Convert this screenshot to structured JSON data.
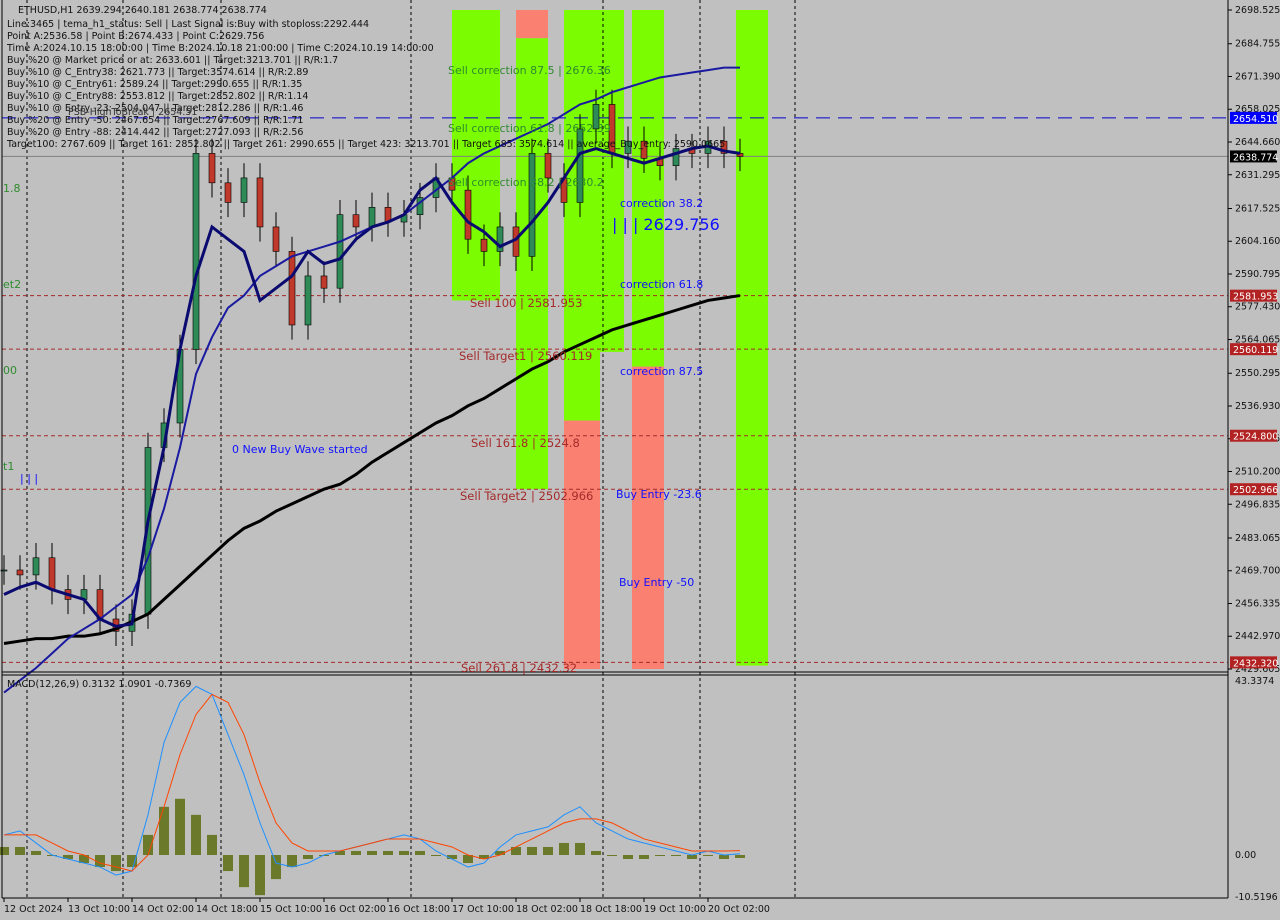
{
  "header": {
    "symbol_line": "ETHUSD,H1  2639.294 2640.181 2638.774 2638.774",
    "info_lines": [
      "Line:3465 | tema_h1_status: Sell | Last Signal is:Buy with stoploss:2292.444",
      "Point A:2536.58 | Point B:2674.433 | Point C:2629.756",
      "Time A:2024.10.15 18:00:00 | Time B:2024.10.18 21:00:00 | Time C:2024.10.19 14:00:00",
      "Buy %20 @ Market price or at: 2633.601 || Target:3213.701 || R/R:1.7",
      "Buy %10 @ C_Entry38: 2621.773 || Target:3574.614 || R/R:2.89",
      "Buy %10 @ C_Entry61: 2589.24 || Target:2990.655 || R/R:1.35",
      "Buy %10 @ C_Entry88: 2553.812 || Target:2852.802 || R/R:1.14",
      "Buy %10 @ Entry -23: 2504.047 || Target:2812.286 || R/R:1.46",
      "Buy %20 @ Entry -50: 2467.654 || Target:2767.609 || R/R:1.71",
      "Buy %20 @ Entry -88: 2414.442 || Target:2727.093 || R/R:2.56",
      "Target100: 2767.609 || Target 161: 2852.802 || Target 261: 2990.655 || Target 423: 3213.701 || Target 685: 3574.614 || average_Buy_entry: 2590.0665"
    ],
    "psb_label": "PSB-HighToBreak | 2654.51"
  },
  "annotations": {
    "sell_corr_875": "Sell correction 87.5 | 2676.36",
    "sell_corr_618": "Sell correction 61.8 | 2652.39",
    "sell_corr_382": "Sell correction 38.2 | 2630.2",
    "corr_382": "correction 38.2",
    "point_c": "| | | 2629.756",
    "corr_618": "correction 61.8",
    "corr_875": "correction 87.5",
    "buy_entry_236": "Buy Entry -23.6",
    "buy_entry_50": "Buy Entry -50",
    "sell_100": "Sell 100 | 2581.953",
    "sell_target1": "Sell Target1 | 2560.119",
    "sell_1618": "Sell 161.8 | 2524.8",
    "sell_target2": "Sell Target2 | 2502.966",
    "sell_2618": "Sell 261.8 | 2432.32",
    "new_wave": "0 New Buy Wave started",
    "left_edge": [
      "1.8",
      "et2",
      "00",
      "t1"
    ],
    "left_bars": "| | |"
  },
  "price_badges": [
    {
      "label": "2654.510",
      "value": 2654.51,
      "color": "#0000ff"
    },
    {
      "label": "2638.774",
      "value": 2638.774,
      "color": "#000000"
    },
    {
      "label": "2581.953",
      "value": 2581.953,
      "color": "#b22222"
    },
    {
      "label": "2560.119",
      "value": 2560.119,
      "color": "#b22222"
    },
    {
      "label": "2524.800",
      "value": 2524.8,
      "color": "#b22222"
    },
    {
      "label": "2502.966",
      "value": 2502.966,
      "color": "#b22222"
    },
    {
      "label": "2432.320",
      "value": 2432.32,
      "color": "#b22222"
    }
  ],
  "colors": {
    "background": "#c0c0c0",
    "bull_zone": "#7cfc00",
    "bear_zone": "#fa8072",
    "level": "#a52a2a",
    "ma_long": "#000000",
    "ma_mid": "#1a1aa0",
    "ma_fast": "#0a0a70",
    "macd": "#1e90ff",
    "signal": "#ff4500",
    "histogram": "#6b7a2a"
  },
  "chart_data": [
    {
      "type": "line",
      "title": "ETHUSD,H1",
      "xlabel": "",
      "ylabel": "",
      "ylim": [
        2429.605,
        2698.525
      ],
      "y_ticks": [
        "2698.525",
        "2684.755",
        "2671.390",
        "2658.025",
        "2644.660",
        "2631.295",
        "2617.525",
        "2604.160",
        "2590.795",
        "2577.430",
        "2564.065",
        "2550.295",
        "2536.930",
        "2523.565",
        "2510.200",
        "2496.835",
        "2483.065",
        "2469.700",
        "2456.335",
        "2442.970",
        "2429.605"
      ],
      "x_ticks": [
        "12 Oct 2024",
        "13 Oct 10:00",
        "14 Oct 02:00",
        "14 Oct 18:00",
        "15 Oct 10:00",
        "16 Oct 02:00",
        "16 Oct 18:00",
        "17 Oct 10:00",
        "18 Oct 02:00",
        "18 Oct 18:00",
        "19 Oct 10:00",
        "20 Oct 02:00"
      ],
      "x": [
        "12 Oct 18:00",
        "12 Oct 22:00",
        "13 Oct 02:00",
        "13 Oct 06:00",
        "13 Oct 10:00",
        "13 Oct 14:00",
        "13 Oct 18:00",
        "13 Oct 22:00",
        "14 Oct 02:00",
        "14 Oct 06:00",
        "14 Oct 10:00",
        "14 Oct 14:00",
        "14 Oct 18:00",
        "14 Oct 22:00",
        "15 Oct 02:00",
        "15 Oct 06:00",
        "15 Oct 10:00",
        "15 Oct 14:00",
        "15 Oct 18:00",
        "15 Oct 22:00",
        "16 Oct 02:00",
        "16 Oct 06:00",
        "16 Oct 10:00",
        "16 Oct 14:00",
        "16 Oct 18:00",
        "16 Oct 22:00",
        "17 Oct 02:00",
        "17 Oct 06:00",
        "17 Oct 10:00",
        "17 Oct 14:00",
        "17 Oct 18:00",
        "17 Oct 22:00",
        "18 Oct 02:00",
        "18 Oct 06:00",
        "18 Oct 10:00",
        "18 Oct 14:00",
        "18 Oct 18:00",
        "18 Oct 22:00",
        "19 Oct 02:00",
        "19 Oct 06:00",
        "19 Oct 10:00",
        "19 Oct 14:00",
        "19 Oct 18:00",
        "19 Oct 22:00",
        "20 Oct 02:00",
        "20 Oct 06:00",
        "20 Oct 09:00"
      ],
      "series": [
        {
          "values": [
            2470,
            2468,
            2475,
            2462,
            2458,
            2462,
            2450,
            2445,
            2452,
            2520,
            2530,
            2560,
            2640,
            2628,
            2620,
            2630,
            2610,
            2600,
            2570,
            2590,
            2585,
            2615,
            2610,
            2618,
            2612,
            2615,
            2622,
            2630,
            2625,
            2605,
            2600,
            2610,
            2598,
            2640,
            2630,
            2620,
            2650,
            2660,
            2640,
            2645,
            2638,
            2635,
            2642,
            2640,
            2645,
            2640,
            2638.774
          ]
        },
        {
          "values": [
            2440,
            2441,
            2442,
            2442,
            2443,
            2443,
            2444,
            2446,
            2449,
            2452,
            2458,
            2464,
            2470,
            2476,
            2482,
            2487,
            2490,
            2494,
            2497,
            2500,
            2503,
            2505,
            2509,
            2514,
            2518,
            2522,
            2526,
            2530,
            2533,
            2537,
            2540,
            2544,
            2548,
            2552,
            2555,
            2559,
            2562,
            2565,
            2568,
            2570,
            2572,
            2574,
            2576,
            2578,
            2580,
            2581,
            2582
          ]
        },
        {
          "values": [
            2420,
            2425,
            2430,
            2436,
            2442,
            2446,
            2450,
            2455,
            2460,
            2475,
            2495,
            2520,
            2550,
            2565,
            2577,
            2582,
            2590,
            2594,
            2598,
            2600,
            2602,
            2604,
            2607,
            2610,
            2612,
            2615,
            2620,
            2625,
            2630,
            2636,
            2640,
            2643,
            2646,
            2649,
            2652,
            2656,
            2660,
            2662,
            2665,
            2667,
            2669,
            2671,
            2672,
            2673,
            2674,
            2675,
            2675
          ]
        },
        {
          "values": [
            2460,
            2463,
            2465,
            2462,
            2460,
            2458,
            2450,
            2447,
            2448,
            2490,
            2520,
            2560,
            2590,
            2610,
            2605,
            2600,
            2580,
            2585,
            2590,
            2600,
            2595,
            2597,
            2605,
            2610,
            2612,
            2615,
            2625,
            2630,
            2620,
            2612,
            2608,
            2602,
            2605,
            2612,
            2620,
            2630,
            2640,
            2642,
            2640,
            2638,
            2636,
            2638,
            2640,
            2642,
            2643,
            2641,
            2640
          ]
        }
      ],
      "levels": [
        2581.953,
        2560.119,
        2524.8,
        2502.966,
        2432.32
      ],
      "psb_level": 2654.51,
      "zones": [
        {
          "from": "17 Oct 10:00",
          "to": "17 Oct 22:00",
          "low": 2580,
          "high": 2698.525,
          "kind": "bull"
        },
        {
          "from": "18 Oct 02:00",
          "to": "18 Oct 10:00",
          "low": 2687,
          "high": 2698.525,
          "kind": "bear"
        },
        {
          "from": "18 Oct 02:00",
          "to": "18 Oct 10:00",
          "low": 2503,
          "high": 2687,
          "kind": "bull"
        },
        {
          "from": "18 Oct 14:00",
          "to": "18 Oct 23:00",
          "low": 2531,
          "high": 2698.525,
          "kind": "bull"
        },
        {
          "from": "18 Oct 14:00",
          "to": "18 Oct 23:00",
          "low": 2429.605,
          "high": 2531,
          "kind": "bear"
        },
        {
          "from": "18 Oct 23:00",
          "to": "19 Oct 05:00",
          "low": 2559,
          "high": 2698.525,
          "kind": "bull"
        },
        {
          "from": "19 Oct 07:00",
          "to": "19 Oct 15:00",
          "low": 2553,
          "high": 2698.525,
          "kind": "bull"
        },
        {
          "from": "19 Oct 07:00",
          "to": "19 Oct 15:00",
          "low": 2429.605,
          "high": 2553,
          "kind": "bear"
        },
        {
          "from": "20 Oct 09:00",
          "to": "20 Oct 17:00",
          "low": 2431,
          "high": 2698.525,
          "kind": "bull"
        }
      ]
    },
    {
      "type": "bar",
      "title": "MACD(12,26,9) 0.3132 1.0901 -0.7369",
      "ylim": [
        -10.5196,
        43.3374
      ],
      "y_ticks": [
        "43.3374",
        "0.00",
        "-10.5196"
      ],
      "macd": [
        5,
        6,
        3,
        0,
        -1,
        -2,
        -3,
        -5,
        -4,
        10,
        28,
        38,
        42,
        40,
        30,
        20,
        8,
        -2,
        -3,
        -2,
        0,
        1,
        2,
        3,
        4,
        5,
        4,
        1,
        -1,
        -3,
        -2,
        2,
        5,
        6,
        7,
        10,
        12,
        8,
        6,
        4,
        3,
        2,
        1,
        0,
        1,
        0,
        0.3132
      ],
      "signal": [
        5,
        5,
        5,
        3,
        1,
        0,
        -2,
        -3,
        -4,
        0,
        12,
        25,
        35,
        40,
        38,
        30,
        18,
        8,
        3,
        1,
        1,
        1,
        2,
        3,
        4,
        4,
        4,
        3,
        2,
        0,
        -1,
        0,
        2,
        4,
        6,
        8,
        9,
        9,
        8,
        6,
        4,
        3,
        2,
        1,
        1,
        1,
        1.0901
      ],
      "histogram": [
        2,
        2,
        1,
        0,
        -1,
        -2,
        -3,
        -4,
        -3,
        5,
        12,
        14,
        10,
        5,
        -4,
        -8,
        -10,
        -6,
        -3,
        -1,
        0,
        1,
        1,
        1,
        1,
        1,
        1,
        0,
        -1,
        -2,
        -1,
        1,
        2,
        2,
        2,
        3,
        3,
        1,
        0,
        -1,
        -1,
        0,
        0,
        -1,
        0,
        -1,
        -0.7369
      ]
    }
  ]
}
